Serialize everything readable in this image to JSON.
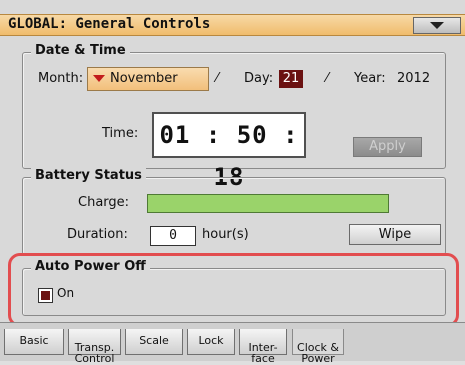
{
  "header": {
    "title": "GLOBAL: General Controls",
    "menu_icon": "triangle-down-icon"
  },
  "date_time": {
    "group_label": "Date & Time",
    "month_label": "Month:",
    "month_value": "November",
    "separator": "⁄",
    "day_label": "Day:",
    "day_value": "21",
    "year_label": "Year:",
    "year_value": "2012",
    "time_label": "Time:",
    "time_value": "01 : 50 : 18",
    "apply_label": "Apply"
  },
  "battery": {
    "group_label": "Battery Status",
    "charge_label": "Charge:",
    "charge_level_percent": 100,
    "duration_label": "Duration:",
    "duration_value": "0",
    "duration_unit": "hour(s)",
    "wipe_label": "Wipe"
  },
  "auto_power": {
    "group_label": "Auto Power Off",
    "checkbox_label": "On",
    "checked": true
  },
  "tabs": [
    {
      "label": "Basic"
    },
    {
      "label": "Transp.\nControl"
    },
    {
      "label": "Scale"
    },
    {
      "label": "Lock"
    },
    {
      "label": "Inter-\nface"
    },
    {
      "label": "Clock &\nPower",
      "active": true
    }
  ],
  "colors": {
    "title_bar": "#f0bc6c",
    "charge_bar": "#9ad36a",
    "highlight": "#e24d4f",
    "day_value_bg": "#6b1212"
  }
}
